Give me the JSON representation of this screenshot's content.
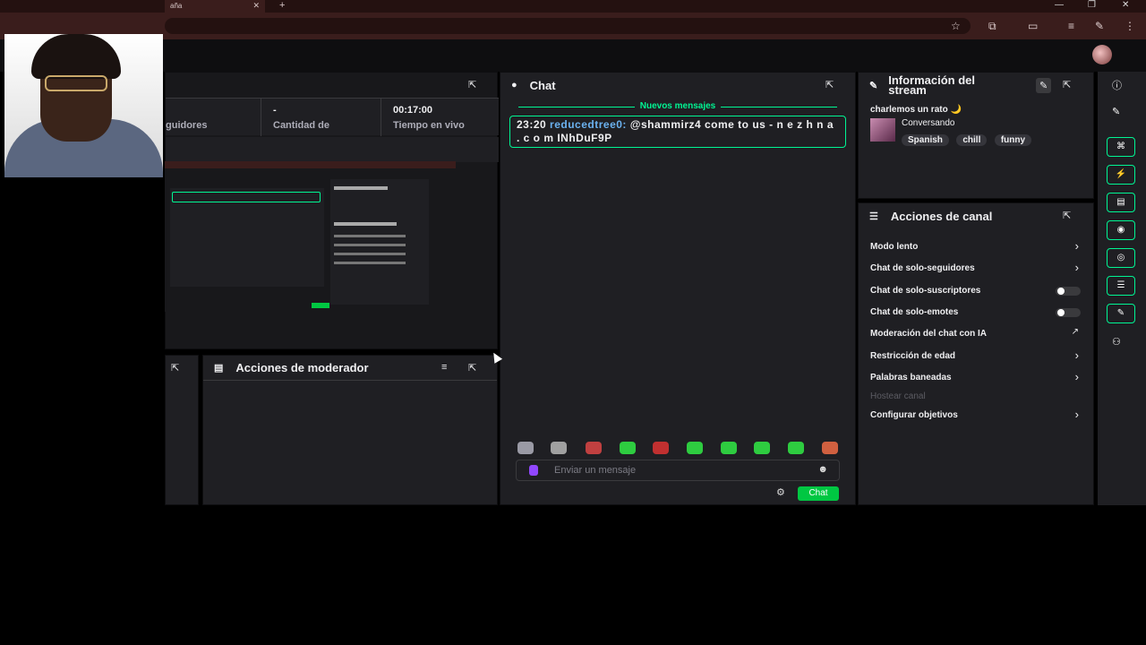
{
  "browser": {
    "tab_title": "aña",
    "tab_close": "✕",
    "new_tab": "+",
    "window_controls": [
      "—",
      "❐",
      "✕"
    ],
    "toolbar_icons": [
      "☆",
      "⧉",
      "▭",
      "≡",
      "✎",
      "⋮"
    ]
  },
  "stats": {
    "followers_label": "guidores",
    "viewers_value": "-",
    "viewers_label": "Cantidad de",
    "live_time_value": "00:17:00",
    "live_time_label": "Tiempo en vivo"
  },
  "chat": {
    "title": "Chat",
    "new_messages": "Nuevos mensajes",
    "message_time": "23:20",
    "message_user": "reducedtree0:",
    "message_text": "@shammirz4 come to us - n e z h n a . c o m INhDuF9P",
    "input_placeholder": "Enviar un mensaje",
    "send_label": "Chat"
  },
  "mod_actions": {
    "title": "Acciones de moderador"
  },
  "stream_info": {
    "title": "Información del stream",
    "stream_title": "charlemos un rato 🌙",
    "category": "Conversando",
    "tags": [
      "Spanish",
      "chill",
      "funny"
    ]
  },
  "channel_actions": {
    "title": "Acciones de canal",
    "items": [
      {
        "label": "Modo lento",
        "control": "arrow"
      },
      {
        "label": "Chat de solo-seguidores",
        "control": "arrow"
      },
      {
        "label": "Chat de solo-suscriptores",
        "control": "toggle"
      },
      {
        "label": "Chat de solo-emotes",
        "control": "toggle"
      },
      {
        "label": "Moderación del chat con IA",
        "control": "link"
      },
      {
        "label": "Restricción de edad",
        "control": "arrow"
      },
      {
        "label": "Palabras baneadas",
        "control": "arrow"
      },
      {
        "label": "Hostear canal",
        "control": "none"
      },
      {
        "label": "Configurar objetivos",
        "control": "arrow"
      }
    ]
  },
  "colors": {
    "accent": "#00f593",
    "button_green": "#00c742",
    "panel_bg": "#1f1f23",
    "username": "#6bb2f0"
  },
  "icons": {
    "popout": "popout-icon",
    "chat": "chat-bubble-icon",
    "wrench": "wrench-icon",
    "pencil": "pencil-icon",
    "info": "info-icon"
  }
}
